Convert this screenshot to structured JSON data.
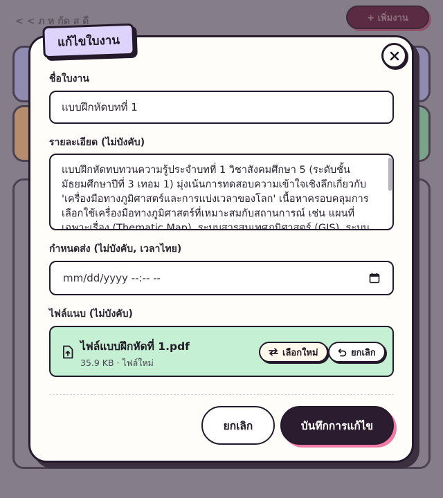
{
  "background": {
    "breadcrumb": "< < ภ ห ก้ด ส ดี",
    "add_button": "+ เพิ่มงาน"
  },
  "modal": {
    "tag": "แก้ไขใบงาน",
    "fields": {
      "name_label": "ชื่อใบงาน",
      "name_value": "แบบฝึกหัดบทที่ 1",
      "desc_label": "รายละเอียด (ไม่บังคับ)",
      "desc_value": "แบบฝึกหัดทบทวนความรู้ประจำบทที่ 1 วิชาสังคมศึกษา 5 (ระดับชั้นมัธยมศึกษาปีที่ 3 เทอม 1) มุ่งเน้นการทดสอบความเข้าใจเชิงลึกเกี่ยวกับ 'เครื่องมือทางภูมิศาสตร์และการแบ่งเวลาของโลก' เนื้อหาครอบคลุมการเลือกใช้เครื่องมือทางภูมิศาสตร์ที่เหมาะสมกับสถานการณ์ เช่น แผนที่เฉพาะเรื่อง (Thematic Map), ระบบสารสนเทศภูมิศาสตร์ (GIS), ระบบ",
      "due_label": "กำหนดส่ง (ไม่บังคับ, เวลาไทย)",
      "due_placeholder": "mm/dd/yyyy --:-- --",
      "attach_label": "ไฟล์แนบ (ไม่บังคับ)"
    },
    "attachment": {
      "file_name": "ไฟล์แบบฝึกหัดที่ 1.pdf",
      "meta": "35.9 KB · ไฟล์ใหม่",
      "reselect_label": "เลือกใหม่",
      "remove_label": "ยกเลิก"
    },
    "buttons": {
      "cancel": "ยกเลิก",
      "save": "บันทึกการแก้ไข"
    }
  },
  "colors": {
    "accent_purple": "#ddd3fb",
    "attachment_green": "#c6f0d4",
    "primary_dark": "#2b1d2f",
    "shadow_pink": "#f07aa6"
  }
}
